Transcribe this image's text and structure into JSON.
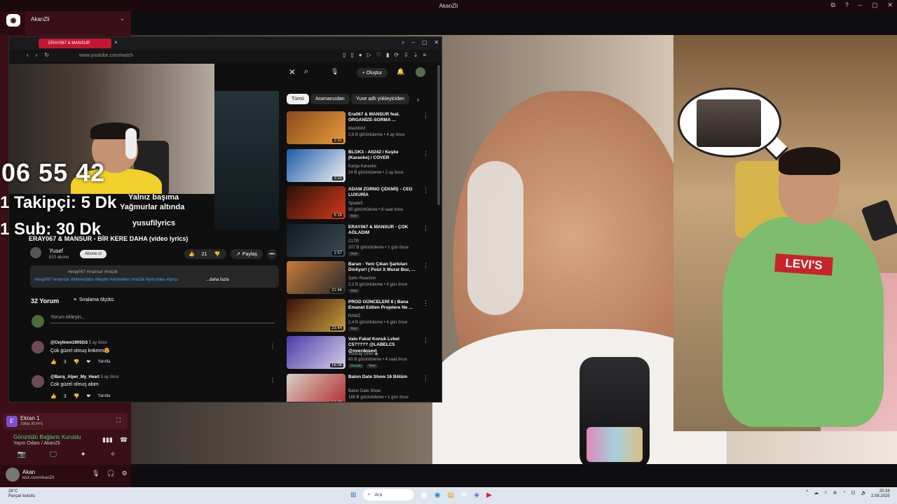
{
  "title_bar": {
    "app_name": "AkanZli",
    "icons": [
      "⧉",
      "?",
      "–",
      "▢",
      "✕"
    ]
  },
  "sidebar": {
    "server_name": "AkanZli",
    "screen_share": {
      "title": "Ekran 1",
      "subtitle": "1080p 30 FPS",
      "option": "⛶"
    },
    "voice": {
      "status": "Görüntülü Bağlantı Kuruldu",
      "room": "Yayın Odası / AkanZli",
      "icons": [
        "▮▮▮",
        "☎"
      ]
    },
    "actions": [
      "📷",
      "🖵",
      "✦",
      "✧"
    ],
    "user": {
      "name": "Akan",
      "status": "kick.com/AkanZli",
      "icons": [
        "🎙",
        "🎧",
        "⚙"
      ]
    }
  },
  "browser": {
    "tab_label": "ERAY067 & MANSUR",
    "url": "www.youtube.com/watch",
    "nav": [
      "‹",
      "›",
      "↻"
    ],
    "ext_icons": [
      "▯",
      "▯",
      "●",
      "▷",
      "♡",
      "▮",
      "⟳",
      "⇩",
      "⇣",
      "≡"
    ],
    "window_icons": [
      "⌕",
      "–",
      "▢",
      "✕"
    ]
  },
  "youtube": {
    "create_label": "Oluştur",
    "lyrics": {
      "line1": "Yalnız başıma",
      "line2": "Yağmurlar altında",
      "site": "yusufilyrics"
    },
    "video_title": "ERAY067 & MANSUR - BİR KERE DAHA (video lyrics)",
    "channel": {
      "name": "Yusef",
      "subs": "823 abone",
      "subscribe_tooltip": "Abone ol"
    },
    "likes": "21",
    "share_label": "Paylaş",
    "description": {
      "tags_line1": "#eray067 #mansur #müzik",
      "tags_line2": "#eray067 #mansur #bikeredaha #keşfet #viralvideo #müzik #lyricvideo #lyrics",
      "more_label": "...daha fazla"
    },
    "comments": {
      "count": "32 Yorum",
      "sort_label": "Sıralama ölçütü:",
      "placeholder": "Yorum ekleyin...",
      "items": [
        {
          "user": "@Ceylinnn1905GS",
          "time": "5 ay önce",
          "text": "Çok güzel olmuş knkmm😍",
          "likes": "3",
          "reply": "Yanıtla"
        },
        {
          "user": "@Barış_Alper_My_Heart",
          "time": "5 ay önce",
          "text": "Cok güzel olmuş abim",
          "likes": "3",
          "reply": "Yanıtla"
        }
      ]
    },
    "chips": [
      "Tümü",
      "Aramanızdan",
      "Yuse adlı yükleyiciden"
    ],
    "recommendations": [
      {
        "title": "Era067 & MANSUR feat. ORGANİZE-SORMA ...",
        "channel": "blackbird",
        "meta": "2,8 B görüntüleme • 4 ay önce",
        "duration": "2:31",
        "badge": "",
        "color1": "#8a4b1a",
        "color2": "#e89a3c"
      },
      {
        "title": "BLOK3 - Atl242 / Keşke (Karaoke) / COVER",
        "channel": "Karga Karaoke",
        "meta": "24 B görüntüleme • 2 ay önce",
        "duration": "3:31",
        "badge": "",
        "color1": "#1b5aa8",
        "color2": "#f2f2f2"
      },
      {
        "title": "ADAM ZORNO ÇEKMİŞ - CEG LUXURİA",
        "channel": "Spade5",
        "meta": "85 görüntüleme • 8 saat önce",
        "duration": "5:18",
        "badge": "Yeni",
        "color1": "#2a1208",
        "color2": "#d3391b"
      },
      {
        "title": "ERAY067 & MANSUR - ÇOK AĞLADIM",
        "channel": "CLTR",
        "meta": "207 B görüntüleme • 1 gün önce",
        "duration": "1:57",
        "badge": "Yeni",
        "color1": "#101a20",
        "color2": "#3a4b55"
      },
      {
        "title": "Baran - Yeni Çıkan Şarkıları Dinliyor! ( Poizi X Murat Boz, ...",
        "channel": "Şarkı Reaction",
        "meta": "2,2 B görüntüleme • 4 gün önce",
        "duration": "21:46",
        "badge": "Yeni",
        "color1": "#c87a3a",
        "color2": "#2b2b2b"
      },
      {
        "title": "PROD GÜNCELERİ 8 | Bana Emanet Edilen Projelere Ne ...",
        "channel": "RAWZ",
        "meta": "2,4 B görüntüleme • 4 gün önce",
        "duration": "23:44",
        "badge": "Yeni",
        "color1": "#3a0d0d",
        "color2": "#c9a13b"
      },
      {
        "title": "Valo Fakat Konuk Lvbel C5????? @LABELC5 @overdosevl",
        "channel": "Tolunay Ören ◉",
        "meta": "60 B görüntüleme • 4 saat önce",
        "duration": "16:08",
        "badge": "Devam",
        "badge2": "Yeni",
        "color1": "#4b3aa8",
        "color2": "#d6cfe8"
      },
      {
        "title": "Balon Date Show 16 Bölüm",
        "channel": "Balon Date Show",
        "meta": "189 B görüntüleme • 1 gün önce",
        "duration": "34:39",
        "badge": "Yeni",
        "color1": "#d9d0c6",
        "color2": "#b22b2b"
      }
    ]
  },
  "overlay": {
    "timer": "06 55 42",
    "follower_goal": "1 Takipçi: 5 Dk",
    "sub_goal": "1 Sub: 30 Dk"
  },
  "photo_label": "LEVI'S",
  "taskbar": {
    "weather_temp": "28°C",
    "weather_desc": "Parçalı bulutlu",
    "search_placeholder": "Ara",
    "apps": [
      "⊞",
      "▣",
      "◉",
      "▤",
      "✉",
      "◈",
      "▶"
    ],
    "tray": [
      "^",
      "☁",
      "⌂",
      "⊛",
      "◔",
      "⊡",
      "🔈"
    ],
    "time": "20:34",
    "date": "2.08.2025"
  }
}
